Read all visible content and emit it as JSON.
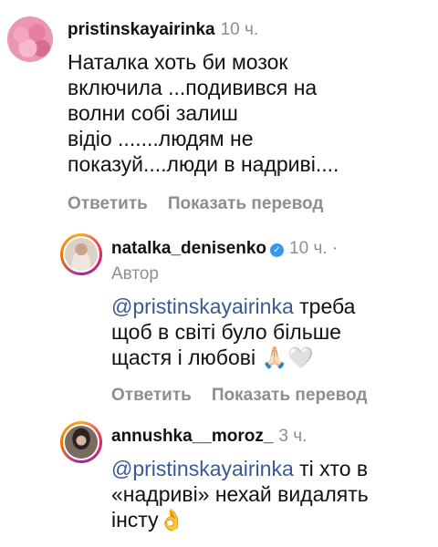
{
  "comments": [
    {
      "username": "pristinskayairinka",
      "time": "10 ч.",
      "lines": [
        "Наталка хоть би  мозок",
        "включила ...подивився на",
        "волни собі залиш",
        "відіо .......людям не",
        "показуй....люди в надриві...."
      ],
      "reply_label": "Ответить",
      "translate_label": "Показать перевод",
      "avatar_icon": "flowers-avatar"
    },
    {
      "username": "natalka_denisenko",
      "verified_icon": "verified-badge-icon",
      "time": "10 ч. ·",
      "author_label": "Автор",
      "mention": "@pristinskayairinka",
      "line1_rest": " треба",
      "line2": "щоб в світі було більше",
      "line3": "щастя і любові 🙏🏻🤍",
      "reply_label": "Ответить",
      "translate_label": "Показать перевод"
    },
    {
      "username": "annushka__moroz_",
      "time": "3 ч.",
      "mention": "@pristinskayairinka",
      "line1_rest": " ті хто в",
      "line2": "«надриві» нехай видалять",
      "line3": "інсту👌"
    }
  ],
  "colors": {
    "mention": "#385898",
    "muted": "#8e8e8e",
    "verified": "#3897f0"
  }
}
